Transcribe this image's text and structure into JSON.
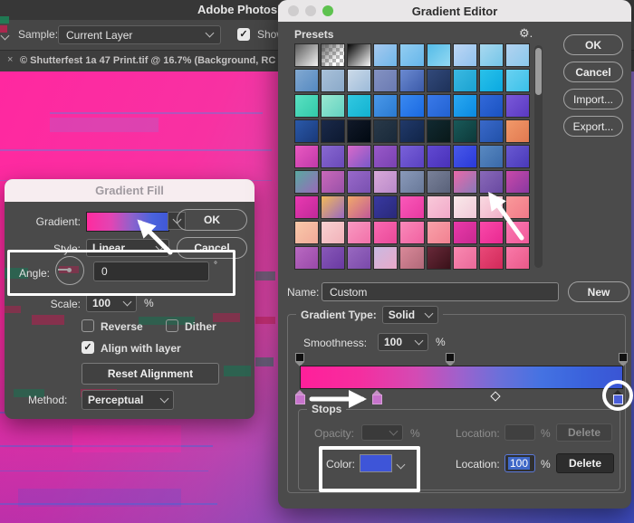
{
  "icons": {
    "check": "✓",
    "close": "×",
    "gear": "⚙.",
    "degree": "°"
  },
  "app": {
    "menu_title": "Adobe Photosho",
    "options_bar": {
      "sample_label": "Sample:",
      "sample_value": "Current Layer",
      "show_label": "Show"
    },
    "document_tab": {
      "title": "© Shutterfest 1a 47 Print.tif @ 16.7% (Background, RC"
    }
  },
  "gradient_fill": {
    "title": "Gradient Fill",
    "gradient_label": "Gradient:",
    "gradient_preview": "linear-gradient(90deg,#ff2b9e 0%,#e145b4 30%,#8e62cc 55%,#4a63dc 80%,#3f57d6 100%)",
    "ok_label": "OK",
    "cancel_label": "Cancel",
    "style_label": "Style:",
    "style_value": "Linear",
    "angle_label": "Angle:",
    "angle_value": "0",
    "angle_unit": "°",
    "scale_label": "Scale:",
    "scale_value": "100",
    "scale_unit": "%",
    "reverse_label": "Reverse",
    "dither_label": "Dither",
    "align_label": "Align with layer",
    "reset_label": "Reset Alignment",
    "method_label": "Method:",
    "method_value": "Perceptual"
  },
  "gradient_editor": {
    "title": "Gradient Editor",
    "presets_label": "Presets",
    "buttons": {
      "ok": "OK",
      "cancel": "Cancel",
      "import": "Import...",
      "export": "Export..."
    },
    "name_label": "Name:",
    "name_value": "Custom",
    "new_label": "New",
    "type_label": "Gradient Type:",
    "type_value": "Solid",
    "smoothness_label": "Smoothness:",
    "smoothness_value": "100",
    "smoothness_unit": "%",
    "bar_gradient": "linear-gradient(90deg,#ff1f9a 0%,#f62d9f 18%,#d34bb4 36%,#9c62cd 50%,#6a70da 62%,#4472e2 75%,#3a62dc 88%,#3a55d4 100%)",
    "stops_label": "Stops",
    "opacity_label": "Opacity:",
    "opacity_unit": "%",
    "color_label": "Color:",
    "color_swatch": "#3e55d8",
    "location_label": "Location:",
    "location_value": "100",
    "location_unit": "%",
    "delete_label": "Delete",
    "stop_colors": {
      "left": "#c773cc",
      "mid": "#c773cc",
      "right": "#4a5ed8"
    },
    "presets": [
      [
        "#5a5a5a",
        "#f2f2f2"
      ],
      "checker",
      [
        "#050505",
        "#fafafa"
      ],
      [
        "#a6c9ef",
        "#6fb7e9"
      ],
      [
        "#92cdf1",
        "#66b6ea"
      ],
      [
        "#54bbe8",
        "#93d9f2"
      ],
      [
        "#bcd6f4",
        "#90c2ee"
      ],
      [
        "#a9d9f0",
        "#74c5e8"
      ],
      [
        "#b2d2f0",
        "#8ac9ec"
      ],
      [
        "#82a9d1",
        "#5589c1"
      ],
      [
        "#a9c1d9",
        "#8aa9c9"
      ],
      [
        "#cddbe9",
        "#9cbad9"
      ],
      [
        "#8492c2",
        "#6a7ab2"
      ],
      [
        "#6b8ad1",
        "#3b5aa9"
      ],
      [
        "#32497a",
        "#1e325a"
      ],
      [
        "#3bb9e1",
        "#1aa2d1"
      ],
      [
        "#2ac1e9",
        "#0aa9e1"
      ],
      [
        "#6ad1f1",
        "#3ac1e9"
      ],
      [
        "#5ae1c2",
        "#32c9a9"
      ],
      [
        "#9ae9d1",
        "#62d1c1"
      ],
      [
        "#32c9e1",
        "#12b1d1"
      ],
      [
        "#4a99e9",
        "#2a79d1"
      ],
      [
        "#3a89f1",
        "#1a69e1"
      ],
      [
        "#3a79e9",
        "#2262d1"
      ],
      [
        "#2aa9f1",
        "#0a89e1"
      ],
      [
        "#3269d9",
        "#1a52c1"
      ],
      [
        "#7a59d9",
        "#5a39c1"
      ],
      [
        "#2a59a9",
        "#1a3979"
      ],
      [
        "#1a2949",
        "#0d1931"
      ],
      [
        "#111929",
        "#010911"
      ],
      [
        "#293949",
        "#192939"
      ],
      [
        "#213969",
        "#112549"
      ],
      [
        "#112931",
        "#091919"
      ],
      [
        "#195959",
        "#0d3939"
      ],
      [
        "#3a69c9",
        "#2151a9"
      ],
      [
        "#f19969",
        "#e17951"
      ],
      [
        "#e959c1",
        "#c139a9"
      ],
      [
        "#8969d1",
        "#6949b9"
      ],
      [
        "#d969c9",
        "#7959c9"
      ],
      [
        "#9959c9",
        "#7941b1"
      ],
      [
        "#7961d9",
        "#5941c1"
      ],
      [
        "#6149d1",
        "#4931b9"
      ],
      [
        "#4959e9",
        "#2939d9"
      ],
      [
        "#5989c1",
        "#3969a9"
      ],
      [
        "#6959d1",
        "#4939b9"
      ],
      [
        "#59a9a1",
        "#9969b9"
      ],
      [
        "#c969b9",
        "#9951a9"
      ],
      [
        "#9969c9",
        "#7951b1"
      ],
      [
        "#d9a9d9",
        "#b989c9"
      ],
      [
        "#8999b9",
        "#697999"
      ],
      [
        "#798199",
        "#596179"
      ],
      [
        "#e969a9",
        "#8979b9"
      ],
      [
        "#8969b9",
        "#6949a1"
      ],
      [
        "#c949a9",
        "#8939a1"
      ],
      [
        "#e939b1",
        "#c12999"
      ],
      [
        "#f1b959",
        "#9969c1"
      ],
      [
        "#f1a969",
        "#c15999"
      ],
      [
        "#3939a1",
        "#292979"
      ],
      [
        "#f959b9",
        "#e939a1"
      ],
      [
        "#f9c9d9",
        "#f1a9c9"
      ],
      [
        "#f9e9e9",
        "#f1c9d9"
      ],
      [
        "#f9d9e1",
        "#f1b1c9"
      ],
      [
        "#f99999",
        "#f17989"
      ],
      [
        "#f9c9a9",
        "#f1a999"
      ],
      [
        "#f9d1d1",
        "#f1b1b9"
      ],
      [
        "#f999c1",
        "#f171a9"
      ],
      [
        "#f969b1",
        "#e94999"
      ],
      [
        "#f989b9",
        "#f161a1"
      ],
      [
        "#f9a1a9",
        "#f18191"
      ],
      [
        "#e939a9",
        "#c92991"
      ],
      [
        "#f949a9",
        "#e92991"
      ],
      [
        "#f979b1",
        "#f15999"
      ],
      [
        "#b969c1",
        "#9949a9"
      ],
      [
        "#8959b9",
        "#6939a1"
      ],
      [
        "#9969c1",
        "#7949a9"
      ],
      [
        "#c9b9e1",
        "#e9a9c9"
      ],
      [
        "#d98999",
        "#b16979"
      ],
      [
        "#692939",
        "#391119"
      ],
      [
        "#f989b1",
        "#e96999"
      ],
      [
        "#e94979",
        "#d12959"
      ],
      [
        "#f979a9",
        "#e95989"
      ]
    ]
  }
}
